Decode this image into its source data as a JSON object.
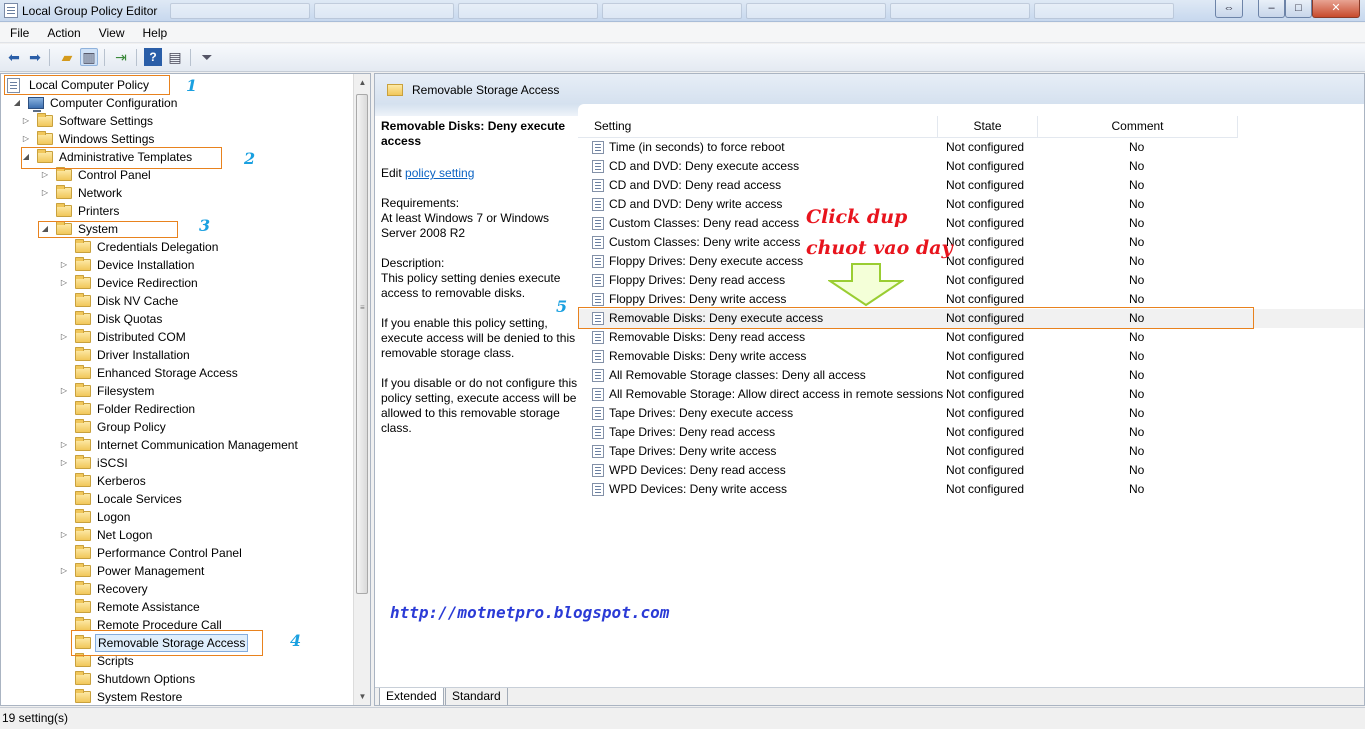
{
  "window": {
    "title": "Local Group Policy Editor",
    "controls": {
      "minimize": "–",
      "maximize": "□",
      "close": "✕",
      "back": "⇔"
    }
  },
  "menu": [
    "File",
    "Action",
    "View",
    "Help"
  ],
  "toolbar": {
    "icons": [
      "back-arrow-icon",
      "forward-arrow-icon",
      "up-folder-icon",
      "show-hide-tree-icon",
      "export-list-icon",
      "help-icon",
      "properties-icon",
      "filter-icon"
    ]
  },
  "tree": [
    {
      "label": "Local Computer Policy",
      "level": 0,
      "icon": "policy",
      "expander": ""
    },
    {
      "label": "Computer Configuration",
      "level": 1,
      "icon": "computer",
      "expander": "open"
    },
    {
      "label": "Software Settings",
      "level": 2,
      "icon": "folder",
      "expander": "closed"
    },
    {
      "label": "Windows Settings",
      "level": 2,
      "icon": "folder",
      "expander": "closed"
    },
    {
      "label": "Administrative Templates",
      "level": 2,
      "icon": "folder",
      "expander": "open"
    },
    {
      "label": "Control Panel",
      "level": 3,
      "icon": "folder",
      "expander": "closed"
    },
    {
      "label": "Network",
      "level": 3,
      "icon": "folder",
      "expander": "closed"
    },
    {
      "label": "Printers",
      "level": 3,
      "icon": "folder",
      "expander": ""
    },
    {
      "label": "System",
      "level": 3,
      "icon": "folder",
      "expander": "open"
    },
    {
      "label": "Credentials Delegation",
      "level": 4,
      "icon": "folder",
      "expander": ""
    },
    {
      "label": "Device Installation",
      "level": 4,
      "icon": "folder",
      "expander": "closed"
    },
    {
      "label": "Device Redirection",
      "level": 4,
      "icon": "folder",
      "expander": "closed"
    },
    {
      "label": "Disk NV Cache",
      "level": 4,
      "icon": "folder",
      "expander": ""
    },
    {
      "label": "Disk Quotas",
      "level": 4,
      "icon": "folder",
      "expander": ""
    },
    {
      "label": "Distributed COM",
      "level": 4,
      "icon": "folder",
      "expander": "closed"
    },
    {
      "label": "Driver Installation",
      "level": 4,
      "icon": "folder",
      "expander": ""
    },
    {
      "label": "Enhanced Storage Access",
      "level": 4,
      "icon": "folder",
      "expander": ""
    },
    {
      "label": "Filesystem",
      "level": 4,
      "icon": "folder",
      "expander": "closed"
    },
    {
      "label": "Folder Redirection",
      "level": 4,
      "icon": "folder",
      "expander": ""
    },
    {
      "label": "Group Policy",
      "level": 4,
      "icon": "folder",
      "expander": ""
    },
    {
      "label": "Internet Communication Management",
      "level": 4,
      "icon": "folder",
      "expander": "closed"
    },
    {
      "label": "iSCSI",
      "level": 4,
      "icon": "folder",
      "expander": "closed"
    },
    {
      "label": "Kerberos",
      "level": 4,
      "icon": "folder",
      "expander": ""
    },
    {
      "label": "Locale Services",
      "level": 4,
      "icon": "folder",
      "expander": ""
    },
    {
      "label": "Logon",
      "level": 4,
      "icon": "folder",
      "expander": ""
    },
    {
      "label": "Net Logon",
      "level": 4,
      "icon": "folder",
      "expander": "closed"
    },
    {
      "label": "Performance Control Panel",
      "level": 4,
      "icon": "folder",
      "expander": ""
    },
    {
      "label": "Power Management",
      "level": 4,
      "icon": "folder",
      "expander": "closed"
    },
    {
      "label": "Recovery",
      "level": 4,
      "icon": "folder",
      "expander": ""
    },
    {
      "label": "Remote Assistance",
      "level": 4,
      "icon": "folder",
      "expander": ""
    },
    {
      "label": "Remote Procedure Call",
      "level": 4,
      "icon": "folder",
      "expander": ""
    },
    {
      "label": "Removable Storage Access",
      "level": 4,
      "icon": "folder",
      "expander": "",
      "selected": true
    },
    {
      "label": "Scripts",
      "level": 4,
      "icon": "folder",
      "expander": ""
    },
    {
      "label": "Shutdown Options",
      "level": 4,
      "icon": "folder",
      "expander": ""
    },
    {
      "label": "System Restore",
      "level": 4,
      "icon": "folder",
      "expander": ""
    }
  ],
  "right_pane": {
    "title": "Removable Storage Access",
    "detail": {
      "title": "Removable Disks: Deny execute access",
      "edit_prefix": "Edit",
      "edit_link": "policy setting",
      "requirements_label": "Requirements:",
      "requirements": "At least Windows 7 or Windows Server 2008 R2",
      "description_label": "Description:",
      "description": "This policy setting denies execute access to removable disks.",
      "enable_text": "If you enable this policy setting, execute access will be denied to this removable storage class.",
      "disable_text": "If you disable or do not configure this policy setting, execute access will be allowed to this removable storage class."
    },
    "columns": [
      "Setting",
      "State",
      "Comment"
    ],
    "rows": [
      {
        "setting": "Time (in seconds) to force reboot",
        "state": "Not configured",
        "comment": "No"
      },
      {
        "setting": "CD and DVD: Deny execute access",
        "state": "Not configured",
        "comment": "No"
      },
      {
        "setting": "CD and DVD: Deny read access",
        "state": "Not configured",
        "comment": "No"
      },
      {
        "setting": "CD and DVD: Deny write access",
        "state": "Not configured",
        "comment": "No"
      },
      {
        "setting": "Custom Classes: Deny read access",
        "state": "Not configured",
        "comment": "No"
      },
      {
        "setting": "Custom Classes: Deny write access",
        "state": "Not configured",
        "comment": "No"
      },
      {
        "setting": "Floppy Drives: Deny execute access",
        "state": "Not configured",
        "comment": "No"
      },
      {
        "setting": "Floppy Drives: Deny read access",
        "state": "Not configured",
        "comment": "No"
      },
      {
        "setting": "Floppy Drives: Deny write access",
        "state": "Not configured",
        "comment": "No"
      },
      {
        "setting": "Removable Disks: Deny execute access",
        "state": "Not configured",
        "comment": "No",
        "highlight": true
      },
      {
        "setting": "Removable Disks: Deny read access",
        "state": "Not configured",
        "comment": "No"
      },
      {
        "setting": "Removable Disks: Deny write access",
        "state": "Not configured",
        "comment": "No"
      },
      {
        "setting": "All Removable Storage classes: Deny all access",
        "state": "Not configured",
        "comment": "No"
      },
      {
        "setting": "All Removable Storage: Allow direct access in remote sessions",
        "state": "Not configured",
        "comment": "No"
      },
      {
        "setting": "Tape Drives: Deny execute access",
        "state": "Not configured",
        "comment": "No"
      },
      {
        "setting": "Tape Drives: Deny read access",
        "state": "Not configured",
        "comment": "No"
      },
      {
        "setting": "Tape Drives: Deny write access",
        "state": "Not configured",
        "comment": "No"
      },
      {
        "setting": "WPD Devices: Deny read access",
        "state": "Not configured",
        "comment": "No"
      },
      {
        "setting": "WPD Devices: Deny write access",
        "state": "Not configured",
        "comment": "No"
      }
    ],
    "tabs": [
      "Extended",
      "Standard"
    ]
  },
  "status": "19 setting(s)",
  "annotations": {
    "numbers": [
      "1",
      "2",
      "3",
      "4",
      "5"
    ],
    "instruction_line1": "Click dup",
    "instruction_line2": "chuot vao day",
    "url": "http://motnetpro.blogspot.com",
    "box_color": "#e8821e",
    "number_color": "#1aa0e0",
    "instruction_color": "#e8141d",
    "arrow_color": "#9acd32",
    "url_color": "#2b3bd6"
  }
}
